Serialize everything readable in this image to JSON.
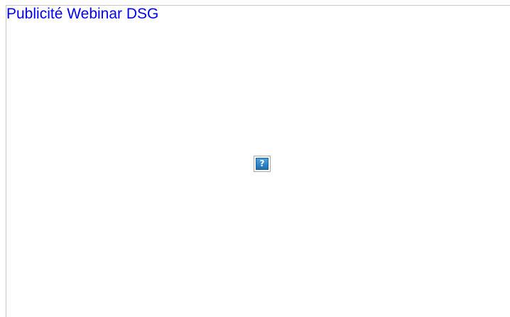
{
  "ad": {
    "link_text": "Publicité Webinar DSG",
    "image_icon": "broken-image-icon",
    "image_glyph": "?"
  },
  "colors": {
    "link": "#0000ee",
    "frame_border": "#c8c8c8",
    "icon_fill": "#2a86c8"
  }
}
